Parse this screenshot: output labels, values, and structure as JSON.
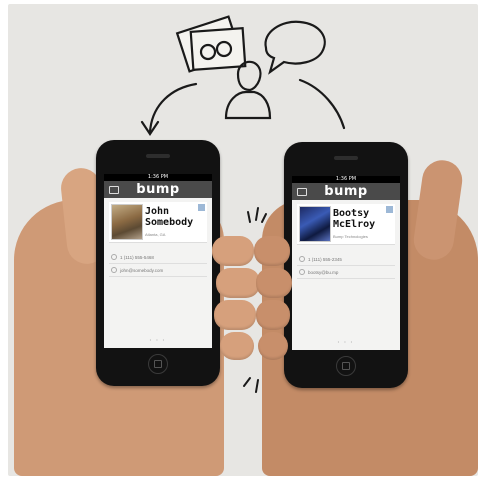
{
  "illustration": {
    "icons": [
      "photos-icon",
      "speech-bubble-icon",
      "person-icon",
      "curved-arrow-icon",
      "motion-marks-icon"
    ]
  },
  "app": {
    "logo_text": "bump",
    "status_time": "1:36 PM"
  },
  "left_phone": {
    "contact_first": "John",
    "contact_last": "Somebody",
    "contact_sub": "Atlanta, GA",
    "phone": "1 (111) 555-5468",
    "email": "john@somebody.com"
  },
  "right_phone": {
    "contact_first": "Bootsy",
    "contact_last": "McElroy",
    "contact_sub": "Bump Technologies",
    "phone": "1 (111) 555-2345",
    "email": "bootsy@bu.mp"
  },
  "colors": {
    "background": "#e7e6e3",
    "phone_body": "#121212",
    "app_bar": "#4a4a4a",
    "skin": "#cf9a76",
    "sketch_stroke": "#1a1a1a"
  }
}
